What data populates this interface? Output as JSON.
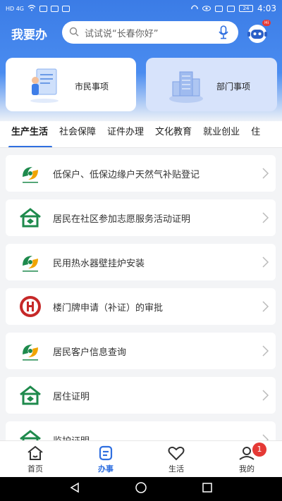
{
  "status_bar": {
    "time": "4:03",
    "battery": "24",
    "left_glyphs": "HD 4G"
  },
  "header": {
    "title": "我要办",
    "search_placeholder": "试试说“长春你好”",
    "robot_badge": "Hi"
  },
  "cards": [
    {
      "label": "市民事项"
    },
    {
      "label": "部门事项"
    }
  ],
  "tabs": [
    "生产生活",
    "社会保障",
    "证件办理",
    "文化教育",
    "就业创业",
    "住"
  ],
  "items": [
    {
      "label": "低保户、低保边缘户天然气补贴登记",
      "icon": "gas-company-logo-icon"
    },
    {
      "label": "居民在社区参加志愿服务活动证明",
      "icon": "community-house-icon"
    },
    {
      "label": "民用热水器壁挂炉安装",
      "icon": "gas-company-logo-icon"
    },
    {
      "label": "楼门牌申请（补证）的审批",
      "icon": "red-seal-icon"
    },
    {
      "label": "居民客户信息查询",
      "icon": "gas-company-logo-icon"
    },
    {
      "label": "居住证明",
      "icon": "community-house-icon"
    },
    {
      "label": "监护证明",
      "icon": "community-house-icon"
    }
  ],
  "bottom_nav": [
    {
      "label": "首页",
      "icon": "home-icon"
    },
    {
      "label": "办事",
      "icon": "service-icon"
    },
    {
      "label": "生活",
      "icon": "heart-icon"
    },
    {
      "label": "我的",
      "icon": "profile-icon",
      "badge": "1"
    }
  ],
  "colors": {
    "primary": "#2f6fe0",
    "badge": "#e53935",
    "green": "#1e8a4c"
  }
}
